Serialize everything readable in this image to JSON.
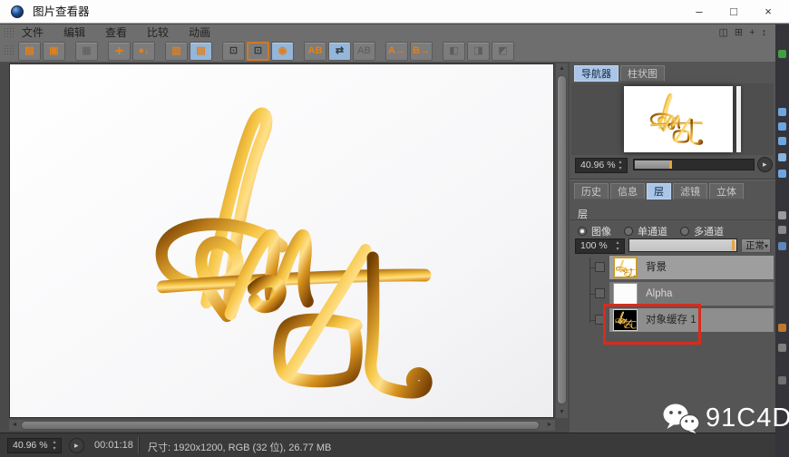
{
  "window": {
    "title": "图片查看器",
    "controls": {
      "minimize": "–",
      "maximize": "□",
      "close": "×"
    }
  },
  "menu": {
    "items": [
      "文件",
      "编辑",
      "查看",
      "比较",
      "动画"
    ],
    "window_icons": [
      "◫",
      "⊞",
      "+",
      "↕"
    ]
  },
  "toolbar": {
    "groups": [
      [
        {
          "name": "open-image",
          "glyph": "▤",
          "style": "o"
        },
        {
          "name": "save-image",
          "glyph": "▣",
          "style": "o"
        }
      ],
      [
        {
          "name": "frame-grid",
          "glyph": "▦",
          "style": "g"
        }
      ],
      [
        {
          "name": "move-image",
          "glyph": "+",
          "style": "o big"
        },
        {
          "name": "render-view",
          "glyph": "●↓",
          "style": "o"
        }
      ],
      [
        {
          "name": "delete-image",
          "glyph": "▥",
          "style": "o"
        },
        {
          "name": "remove-image",
          "glyph": "▤",
          "style": "o blue"
        }
      ],
      [
        {
          "name": "compare-frame-a",
          "glyph": "⊡",
          "style": "d"
        },
        {
          "name": "compare-frame-b",
          "glyph": "⊡",
          "style": "d osel"
        },
        {
          "name": "compare-ball",
          "glyph": "◉",
          "style": "o blue"
        }
      ],
      [
        {
          "name": "ab-compare",
          "glyph": "AB",
          "style": "o"
        },
        {
          "name": "ab-swap",
          "glyph": "⇄",
          "style": "d blue"
        },
        {
          "name": "ab-off",
          "glyph": "AB",
          "style": "g"
        }
      ],
      [
        {
          "name": "set-image-a",
          "glyph": "A→",
          "style": "o"
        },
        {
          "name": "set-image-b",
          "glyph": "B→",
          "style": "o"
        }
      ],
      [
        {
          "name": "compare-mode-1",
          "glyph": "◧",
          "style": "g"
        },
        {
          "name": "compare-mode-2",
          "glyph": "◨",
          "style": "g"
        },
        {
          "name": "compare-mode-3",
          "glyph": "◩",
          "style": "g"
        }
      ]
    ]
  },
  "navigator": {
    "tabs": [
      "导航器",
      "柱状图"
    ],
    "active_tab": "导航器",
    "zoom_value": "40.96 %"
  },
  "layers_panel": {
    "tabs": [
      "历史",
      "信息",
      "层",
      "滤镜",
      "立体"
    ],
    "active_tab": "层",
    "section_label": "层",
    "modes": [
      "图像",
      "单通道",
      "多通道"
    ],
    "selected_mode": "图像",
    "opacity": "100 %",
    "blend_mode": "正常",
    "layers": [
      {
        "name": "背景",
        "selected": true
      },
      {
        "name": "Alpha",
        "selected": false
      },
      {
        "name": "对象缓存 1",
        "selected": false,
        "annotated": true
      }
    ]
  },
  "statusbar": {
    "zoom": "40.96 %",
    "time": "00:01:18",
    "info": "尺寸: 1920x1200, RGB (32 位), 26.77 MB"
  },
  "watermark": {
    "text": "91C4D"
  },
  "colors": {
    "accent_orange": "#e0801f",
    "selected_blue": "#a9c6e8",
    "annotation_red": "#d92b1c",
    "gold": "#d99b1f",
    "panel_gray": "#555555"
  }
}
